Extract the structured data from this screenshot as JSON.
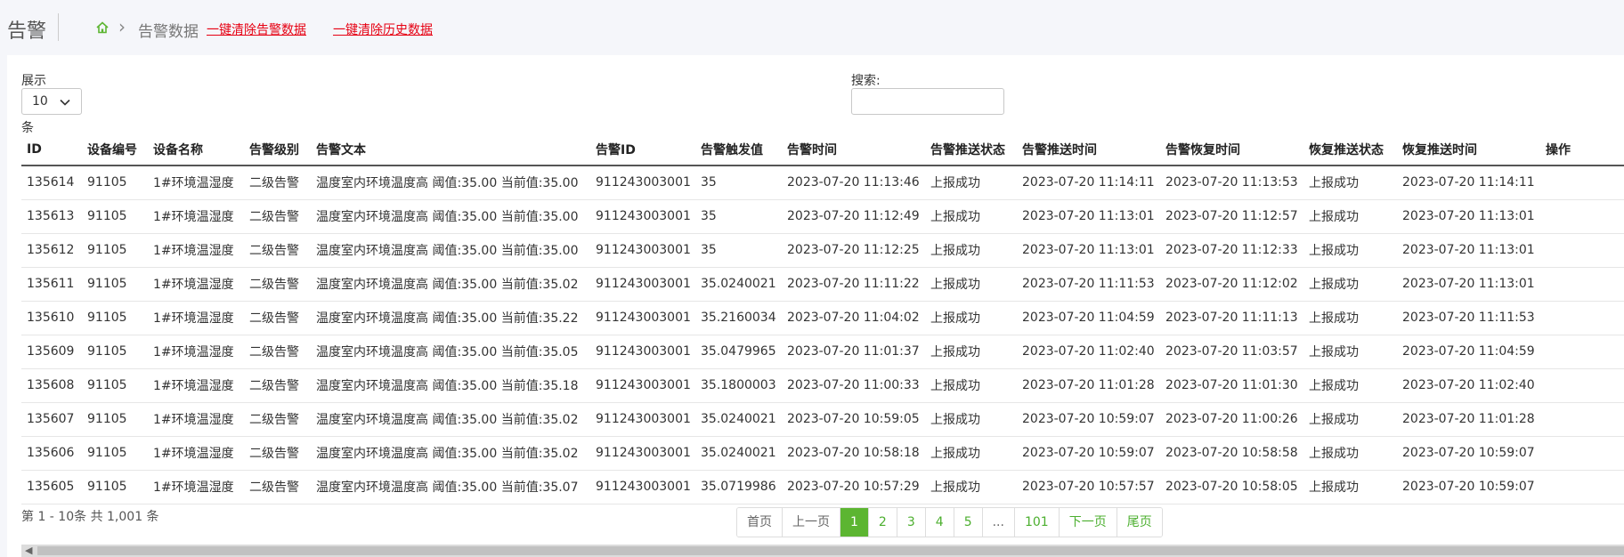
{
  "header": {
    "title": "告警",
    "breadcrumb": "告警数据",
    "clear_alarm_link": "一键清除告警数据",
    "clear_history_link": "一键清除历史数据"
  },
  "controls": {
    "show_label": "展示",
    "page_size": "10",
    "unit_label": "条",
    "search_label": "搜索:",
    "search_value": ""
  },
  "table": {
    "columns": [
      "ID",
      "设备编号",
      "设备名称",
      "告警级别",
      "告警文本",
      "告警ID",
      "告警触发值",
      "告警时间",
      "告警推送状态",
      "告警推送时间",
      "告警恢复时间",
      "恢复推送状态",
      "恢复推送时间",
      "操作"
    ],
    "rows": [
      [
        "135614",
        "91105",
        "1#环境温湿度",
        "二级告警",
        "温度室内环境温度高 阈值:35.00 当前值:35.00",
        "911243003001",
        "35",
        "2023-07-20 11:13:46",
        "上报成功",
        "2023-07-20 11:14:11",
        "2023-07-20 11:13:53",
        "上报成功",
        "2023-07-20 11:14:11",
        ""
      ],
      [
        "135613",
        "91105",
        "1#环境温湿度",
        "二级告警",
        "温度室内环境温度高 阈值:35.00 当前值:35.00",
        "911243003001",
        "35",
        "2023-07-20 11:12:49",
        "上报成功",
        "2023-07-20 11:13:01",
        "2023-07-20 11:12:57",
        "上报成功",
        "2023-07-20 11:13:01",
        ""
      ],
      [
        "135612",
        "91105",
        "1#环境温湿度",
        "二级告警",
        "温度室内环境温度高 阈值:35.00 当前值:35.00",
        "911243003001",
        "35",
        "2023-07-20 11:12:25",
        "上报成功",
        "2023-07-20 11:13:01",
        "2023-07-20 11:12:33",
        "上报成功",
        "2023-07-20 11:13:01",
        ""
      ],
      [
        "135611",
        "91105",
        "1#环境温湿度",
        "二级告警",
        "温度室内环境温度高 阈值:35.00 当前值:35.02",
        "911243003001",
        "35.0240021",
        "2023-07-20 11:11:22",
        "上报成功",
        "2023-07-20 11:11:53",
        "2023-07-20 11:12:02",
        "上报成功",
        "2023-07-20 11:13:01",
        ""
      ],
      [
        "135610",
        "91105",
        "1#环境温湿度",
        "二级告警",
        "温度室内环境温度高 阈值:35.00 当前值:35.22",
        "911243003001",
        "35.2160034",
        "2023-07-20 11:04:02",
        "上报成功",
        "2023-07-20 11:04:59",
        "2023-07-20 11:11:13",
        "上报成功",
        "2023-07-20 11:11:53",
        ""
      ],
      [
        "135609",
        "91105",
        "1#环境温湿度",
        "二级告警",
        "温度室内环境温度高 阈值:35.00 当前值:35.05",
        "911243003001",
        "35.0479965",
        "2023-07-20 11:01:37",
        "上报成功",
        "2023-07-20 11:02:40",
        "2023-07-20 11:03:57",
        "上报成功",
        "2023-07-20 11:04:59",
        ""
      ],
      [
        "135608",
        "91105",
        "1#环境温湿度",
        "二级告警",
        "温度室内环境温度高 阈值:35.00 当前值:35.18",
        "911243003001",
        "35.1800003",
        "2023-07-20 11:00:33",
        "上报成功",
        "2023-07-20 11:01:28",
        "2023-07-20 11:01:30",
        "上报成功",
        "2023-07-20 11:02:40",
        ""
      ],
      [
        "135607",
        "91105",
        "1#环境温湿度",
        "二级告警",
        "温度室内环境温度高 阈值:35.00 当前值:35.02",
        "911243003001",
        "35.0240021",
        "2023-07-20 10:59:05",
        "上报成功",
        "2023-07-20 10:59:07",
        "2023-07-20 11:00:26",
        "上报成功",
        "2023-07-20 11:01:28",
        ""
      ],
      [
        "135606",
        "91105",
        "1#环境温湿度",
        "二级告警",
        "温度室内环境温度高 阈值:35.00 当前值:35.02",
        "911243003001",
        "35.0240021",
        "2023-07-20 10:58:18",
        "上报成功",
        "2023-07-20 10:59:07",
        "2023-07-20 10:58:58",
        "上报成功",
        "2023-07-20 10:59:07",
        ""
      ],
      [
        "135605",
        "91105",
        "1#环境温湿度",
        "二级告警",
        "温度室内环境温度高 阈值:35.00 当前值:35.07",
        "911243003001",
        "35.0719986",
        "2023-07-20 10:57:29",
        "上报成功",
        "2023-07-20 10:57:57",
        "2023-07-20 10:58:05",
        "上报成功",
        "2023-07-20 10:59:07",
        ""
      ]
    ]
  },
  "footer": {
    "info": "第 1 - 10条 共 1,001 条",
    "pagination": [
      {
        "label": "首页",
        "state": "disabled"
      },
      {
        "label": "上一页",
        "state": "disabled"
      },
      {
        "label": "1",
        "state": "active"
      },
      {
        "label": "2",
        "state": "normal"
      },
      {
        "label": "3",
        "state": "normal"
      },
      {
        "label": "4",
        "state": "normal"
      },
      {
        "label": "5",
        "state": "normal"
      },
      {
        "label": "...",
        "state": "disabled"
      },
      {
        "label": "101",
        "state": "normal"
      },
      {
        "label": "下一页",
        "state": "normal"
      },
      {
        "label": "尾页",
        "state": "normal"
      }
    ]
  },
  "colors": {
    "accent": "#5cb531",
    "link_red": "#e60012"
  },
  "icons": [
    "home-icon",
    "chevron-right-icon",
    "chevron-down-icon",
    "scroll-left-arrow-icon"
  ]
}
